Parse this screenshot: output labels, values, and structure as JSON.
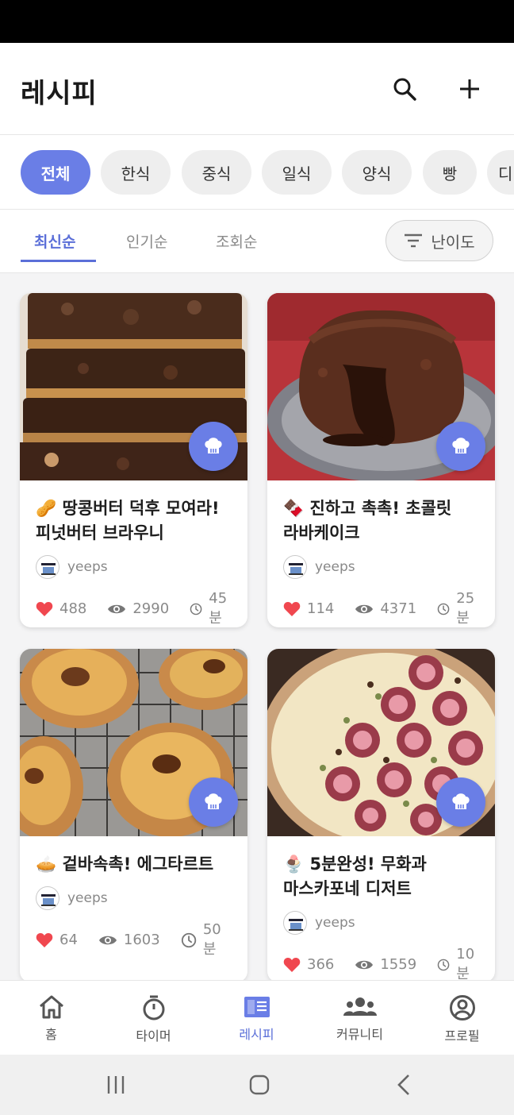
{
  "header": {
    "title": "레시피",
    "search_icon": "search-icon",
    "add_icon": "plus-icon"
  },
  "categories": [
    {
      "label": "전체",
      "active": true
    },
    {
      "label": "한식",
      "active": false
    },
    {
      "label": "중식",
      "active": false
    },
    {
      "label": "일식",
      "active": false
    },
    {
      "label": "양식",
      "active": false
    },
    {
      "label": "빵",
      "active": false
    },
    {
      "label": "디",
      "active": false
    }
  ],
  "sort": {
    "tabs": [
      {
        "label": "최신순"
      },
      {
        "label": "인기순"
      },
      {
        "label": "조회순"
      }
    ],
    "active_index": 0,
    "difficulty_label": "난이도"
  },
  "recipes": [
    {
      "title_line1": "🥜 땅콩버터 덕후 모여라!",
      "title_line2": "피넛버터 브라우니",
      "author": "yeeps",
      "likes": "488",
      "views": "2990",
      "time": "45분"
    },
    {
      "title_line1": "🍫 진하고 촉촉! 초콜릿",
      "title_line2": "라바케이크",
      "author": "yeeps",
      "likes": "114",
      "views": "4371",
      "time": "25분"
    },
    {
      "title_line1": "🥧 겉바속촉! 에그타르트",
      "title_line2": "",
      "author": "yeeps",
      "likes": "64",
      "views": "1603",
      "time": "50분"
    },
    {
      "title_line1": "🍨 5분완성! 무화과",
      "title_line2": "마스카포네 디저트",
      "author": "yeeps",
      "likes": "366",
      "views": "1559",
      "time": "10분"
    }
  ],
  "nav": [
    {
      "label": "홈",
      "icon": "home-icon"
    },
    {
      "label": "타이머",
      "icon": "timer-icon"
    },
    {
      "label": "레시피",
      "icon": "recipe-book-icon",
      "active": true
    },
    {
      "label": "커뮤니티",
      "icon": "community-icon"
    },
    {
      "label": "프로필",
      "icon": "profile-icon"
    }
  ],
  "colors": {
    "accent": "#6a7ee6",
    "heart": "#f0474f"
  }
}
